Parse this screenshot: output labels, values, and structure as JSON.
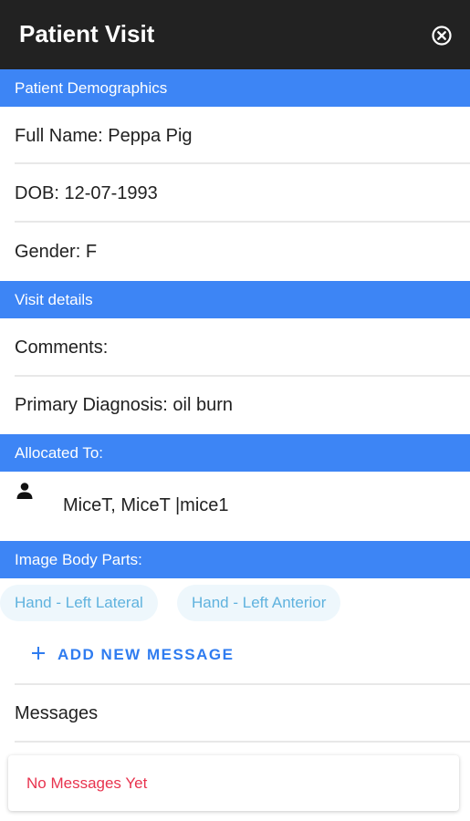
{
  "header": {
    "title": "Patient Visit",
    "close_icon": "close-circle-icon"
  },
  "demographics": {
    "heading": "Patient Demographics",
    "full_name": "Full Name: Peppa Pig",
    "dob": "DOB: 12-07-1993",
    "gender": "Gender: F"
  },
  "visit": {
    "heading": "Visit details",
    "comments": "Comments:",
    "primary_diagnosis": "Primary Diagnosis: oil burn"
  },
  "allocated": {
    "heading": "Allocated To:",
    "icon": "person-icon",
    "value": "MiceT, MiceT |mice1"
  },
  "body_parts": {
    "heading": "Image Body Parts:",
    "chips": [
      "Hand - Left Lateral",
      "Hand - Left Anterior"
    ]
  },
  "messages": {
    "add_label": "ADD NEW MESSAGE",
    "title": "Messages",
    "empty_text": "No Messages Yet"
  },
  "colors": {
    "header_bg": "#222222",
    "section_bg": "#3d85f5",
    "accent_blue": "#2f7cf0",
    "chip_bg": "#eef7fc",
    "chip_text": "#5fb2de",
    "empty_text": "#e8334e"
  }
}
